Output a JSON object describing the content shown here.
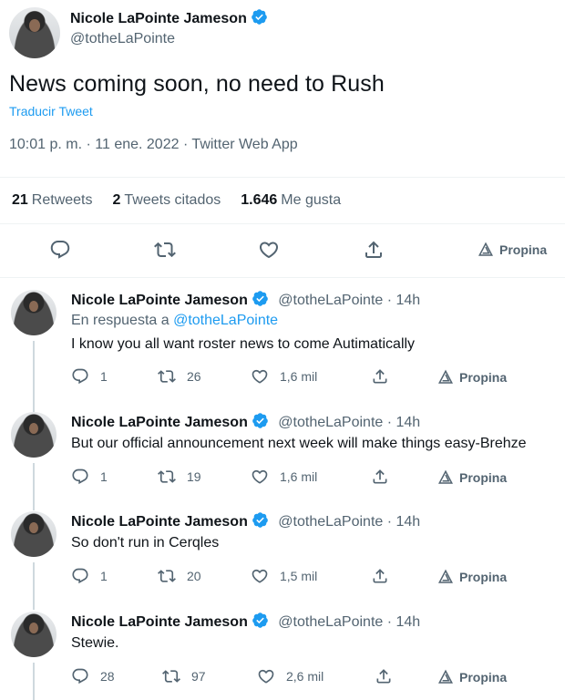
{
  "main_tweet": {
    "author_name": "Nicole LaPointe Jameson",
    "handle": "@totheLaPointe",
    "text": "News coming soon, no need to Rush",
    "translate_label": "Traducir Tweet",
    "meta": "10:01 p. m. · 11 ene. 2022 · Twitter Web App",
    "stats": {
      "retweets_count": "21",
      "retweets_label": "Retweets",
      "quotes_count": "2",
      "quotes_label": "Tweets citados",
      "likes_count": "1.646",
      "likes_label": "Me gusta"
    },
    "tip_label": "Propina"
  },
  "replies": [
    {
      "name": "Nicole LaPointe Jameson",
      "handle_time": "@totheLaPointe · 14h",
      "reply_to_prefix": "En respuesta a ",
      "reply_to_handle": "@totheLaPointe",
      "text": "I know you all want roster news to come Autimatically",
      "replies": "1",
      "retweets": "26",
      "likes": "1,6 mil",
      "tip": "Propina"
    },
    {
      "name": "Nicole LaPointe Jameson",
      "handle_time": "@totheLaPointe · 14h",
      "text": "But our official announcement next week will make things easy-Brehze",
      "replies": "1",
      "retweets": "19",
      "likes": "1,6 mil",
      "tip": "Propina"
    },
    {
      "name": "Nicole LaPointe Jameson",
      "handle_time": "@totheLaPointe · 14h",
      "text": "So don't run in Cerqles",
      "replies": "1",
      "retweets": "20",
      "likes": "1,5 mil",
      "tip": "Propina"
    },
    {
      "name": "Nicole LaPointe Jameson",
      "handle_time": "@totheLaPointe · 14h",
      "text": "Stewie.",
      "replies": "28",
      "retweets": "97",
      "likes": "2,6 mil",
      "tip": "Propina"
    }
  ],
  "colors": {
    "accent": "#1d9bf0",
    "text": "#0f1419",
    "secondary": "#536471",
    "verified_badge": "#1d9bf0"
  },
  "icons": [
    "verified-icon",
    "reply-icon",
    "retweet-icon",
    "like-icon",
    "share-icon",
    "tip-icon"
  ]
}
